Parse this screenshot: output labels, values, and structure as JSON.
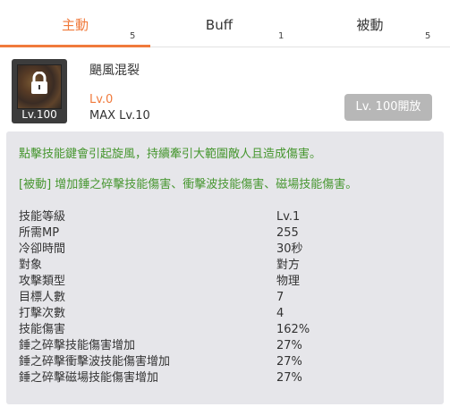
{
  "tabs": [
    {
      "label": "主動",
      "count": "5",
      "active": true
    },
    {
      "label": "Buff",
      "count": "1",
      "active": false
    },
    {
      "label": "被動",
      "count": "5",
      "active": false
    }
  ],
  "skill": {
    "name": "颶風混裂",
    "icon_level": "Lv.100",
    "icon": "lock-icon",
    "current_level": "Lv.0",
    "max_level": "MAX Lv.10",
    "unlock_button": "Lv. 100開放"
  },
  "description": {
    "active": "點擊技能鍵會引起旋風，持續牽引大範圍敵人且造成傷害。",
    "passive": "[被動] 增加錘之碎擊技能傷害、衝擊波技能傷害、磁場技能傷害。"
  },
  "stats": [
    {
      "label": "技能等級",
      "value": "Lv.1"
    },
    {
      "label": "所需MP",
      "value": "255"
    },
    {
      "label": "冷卻時間",
      "value": "30秒"
    },
    {
      "label": "對象",
      "value": "對方"
    },
    {
      "label": "攻擊類型",
      "value": "物理"
    },
    {
      "label": "目標人數",
      "value": "7"
    },
    {
      "label": "打擊次數",
      "value": "4"
    },
    {
      "label": "技能傷害",
      "value": "162%"
    },
    {
      "label": "錘之碎擊技能傷害增加",
      "value": "27%"
    },
    {
      "label": "錘之碎擊衝擊波技能傷害增加",
      "value": "27%"
    },
    {
      "label": "錘之碎擊磁場技能傷害增加",
      "value": "27%"
    }
  ],
  "colors": {
    "accent": "#f07a3c",
    "description_green": "#46962f",
    "panel_bg": "#e6e6ea",
    "button_disabled": "#b7b7b7"
  }
}
